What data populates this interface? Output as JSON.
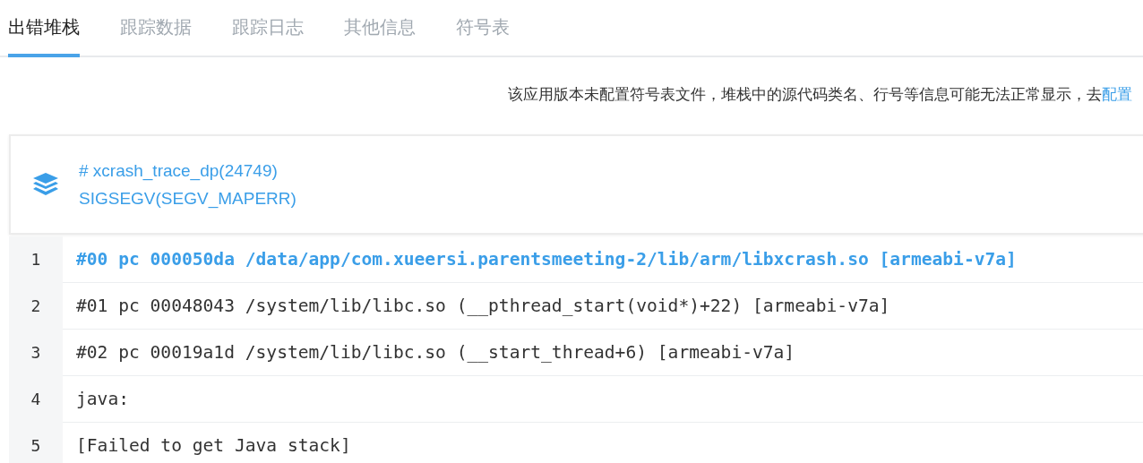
{
  "tabs": [
    {
      "label": "出错堆栈",
      "selected": true
    },
    {
      "label": "跟踪数据",
      "selected": false
    },
    {
      "label": "跟踪日志",
      "selected": false
    },
    {
      "label": "其他信息",
      "selected": false
    },
    {
      "label": "符号表",
      "selected": false
    }
  ],
  "notice": {
    "text": "该应用版本未配置符号表文件，堆栈中的源代码类名、行号等信息可能无法正常显示，去",
    "link": "配置"
  },
  "thread_card": {
    "title": "# xcrash_trace_dp(24749)",
    "signal": "SIGSEGV(SEGV_MAPERR)"
  },
  "stack_lines": [
    {
      "number": "1",
      "text": "#00 pc 000050da /data/app/com.xueersi.parentsmeeting-2/lib/arm/libxcrash.so [armeabi-v7a]",
      "highlighted": true
    },
    {
      "number": "2",
      "text": "#01 pc 00048043 /system/lib/libc.so (__pthread_start(void*)+22) [armeabi-v7a]",
      "highlighted": false
    },
    {
      "number": "3",
      "text": "#02 pc 00019a1d /system/lib/libc.so (__start_thread+6) [armeabi-v7a]",
      "highlighted": false
    },
    {
      "number": "4",
      "text": "java:",
      "highlighted": false
    },
    {
      "number": "5",
      "text": "[Failed to get Java stack]",
      "highlighted": false
    }
  ]
}
